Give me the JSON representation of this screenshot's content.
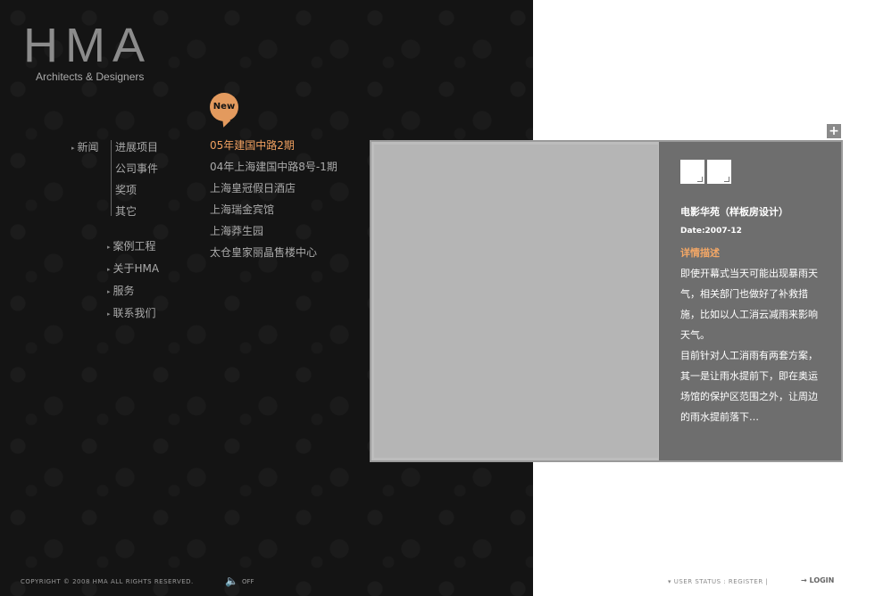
{
  "brand": {
    "logo": "HMA",
    "tagline": "Architects & Designers"
  },
  "nav": {
    "news": "新闻",
    "sub_items": [
      "进展项目",
      "公司事件",
      "奖项",
      "其它"
    ],
    "lower_items": [
      "案例工程",
      "关于HMA",
      "服务",
      "联系我们"
    ]
  },
  "badge": {
    "new": "New"
  },
  "projects": [
    "05年建国中路2期",
    "04年上海建国中路8号-1期",
    "上海皇冠假日酒店",
    "上海瑞金宾馆",
    "上海莽生园",
    "太仓皇家丽晶售楼中心"
  ],
  "popup": {
    "expand_symbol": "+",
    "title": "电影华苑（样板房设计）",
    "date": "Date:2007-12",
    "subhead": "详情描述",
    "paragraphs": [
      "即使开幕式当天可能出现暴雨天气，相关部门也做好了补救措施，比如以人工消云减雨来影响天气。",
      "目前针对人工消雨有两套方案，其一是让雨水提前下，即在奥运场馆的保护区范围之外，让周边的雨水提前落下…"
    ]
  },
  "footer": {
    "copyright": "COPYRIGHT © 2008 HMA ALL RIGHTS RESERVED.",
    "sound_off": "OFF",
    "user_status": "USER STATUS",
    "register": "REGISTER",
    "separator": "|",
    "login": "LOGIN"
  },
  "colors": {
    "accent": "#f0a060",
    "dark_bg": "#141414",
    "popup_info_bg": "#6e6e6e"
  }
}
